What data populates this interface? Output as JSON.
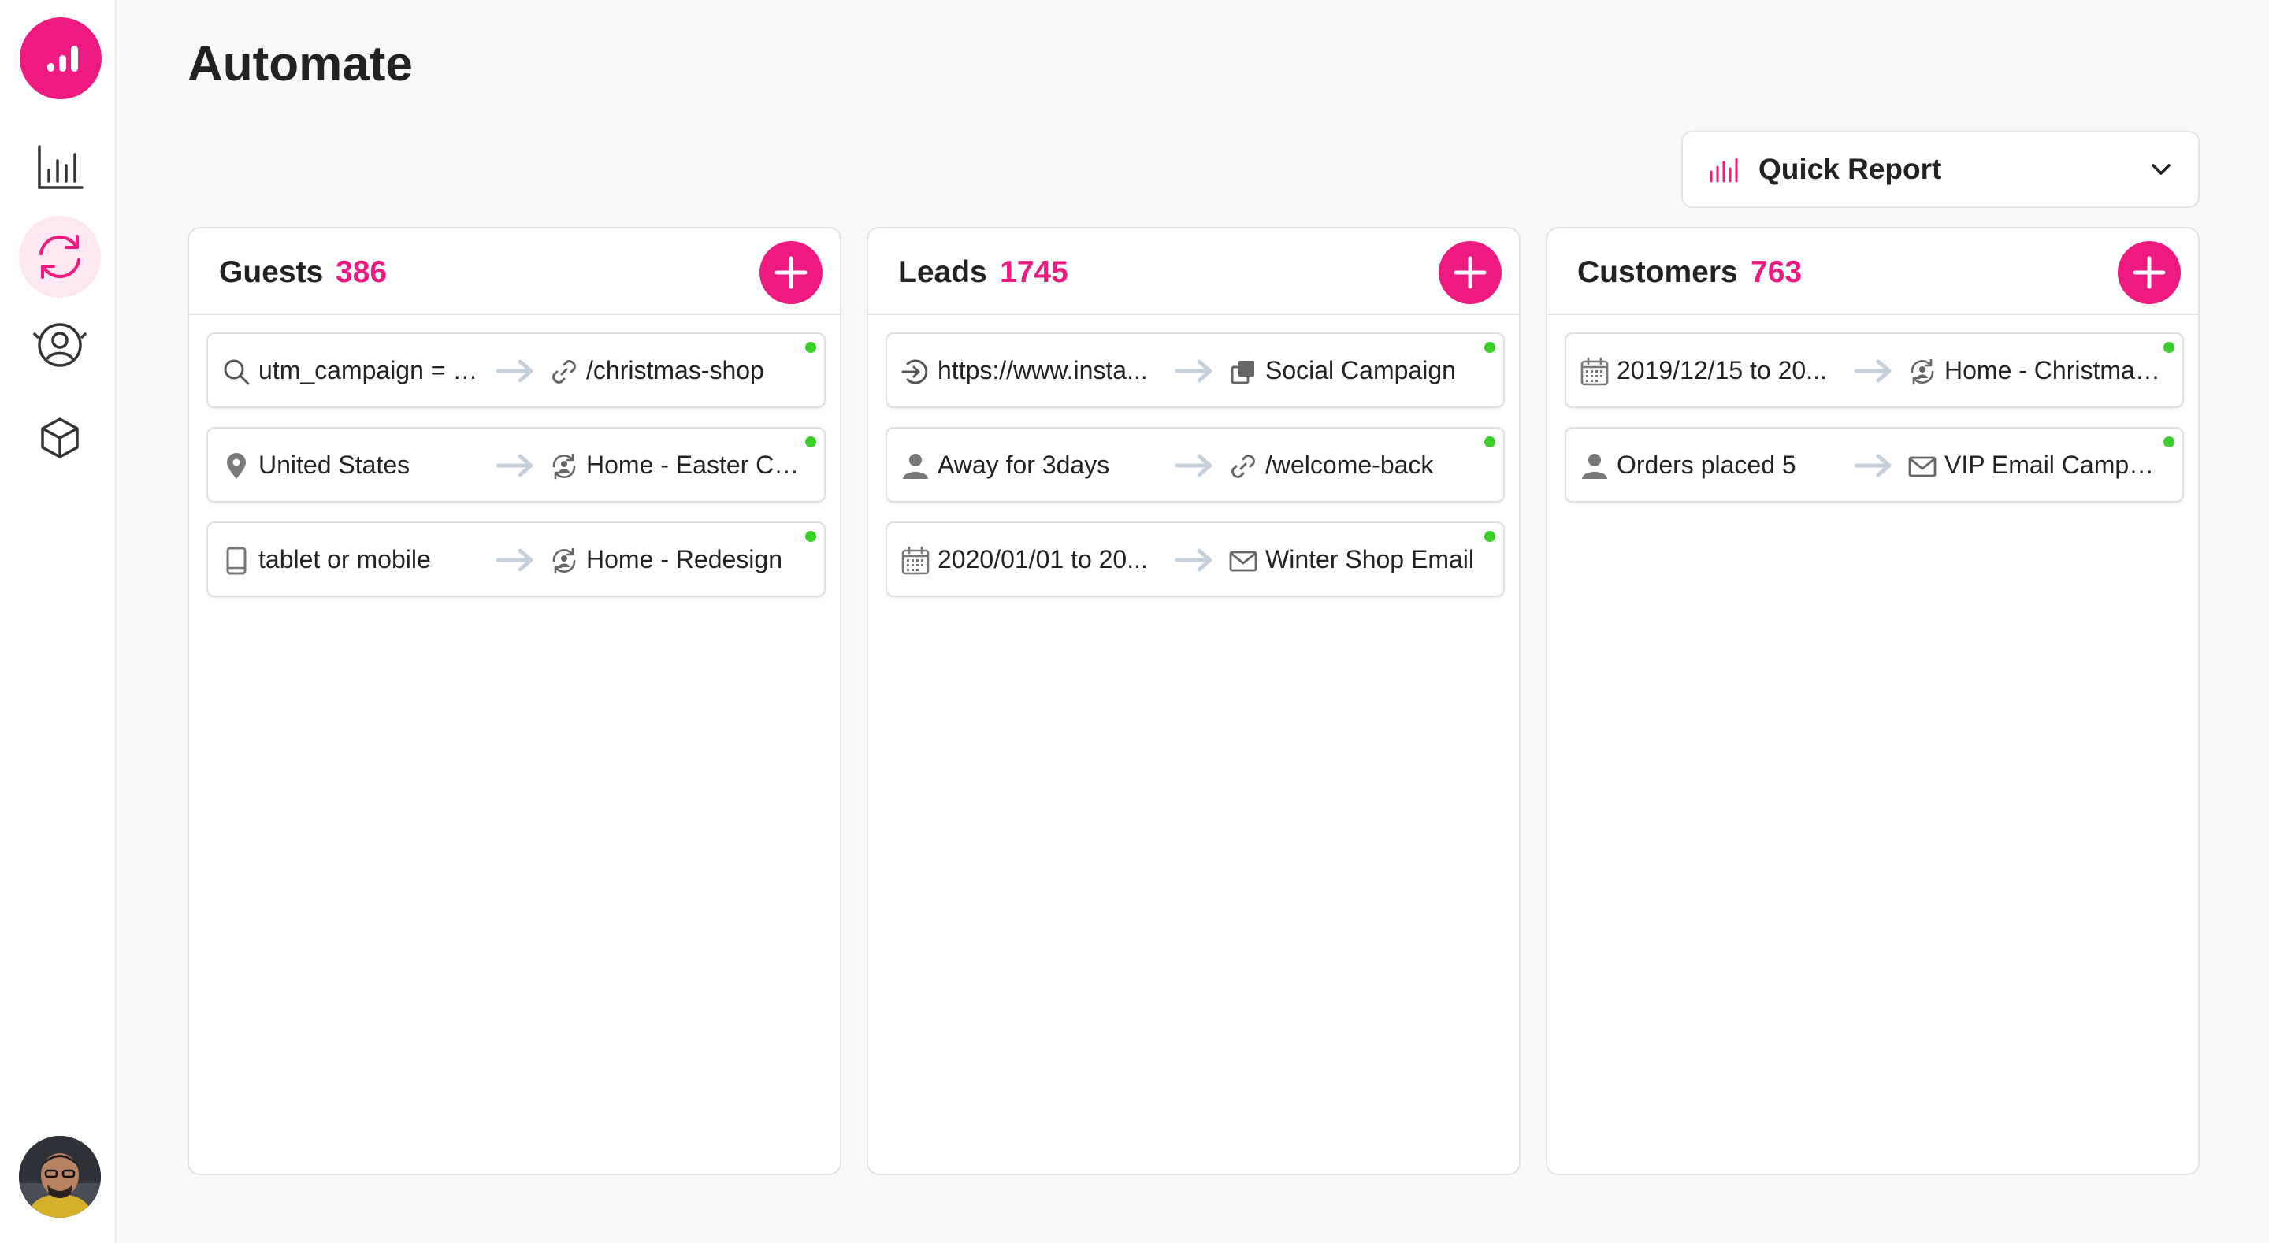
{
  "app": {
    "title": "Automate"
  },
  "sidebar": {
    "items": [
      {
        "name": "analytics",
        "icon": "bar-chart-icon"
      },
      {
        "name": "automate",
        "icon": "refresh-cycle-icon",
        "active": true
      },
      {
        "name": "audience",
        "icon": "user-circle-icon"
      },
      {
        "name": "products",
        "icon": "cube-icon"
      }
    ]
  },
  "quick_report": {
    "label": "Quick Report",
    "icon": "bar-chart-icon"
  },
  "colors": {
    "accent": "#ef1a7f",
    "status_active": "#3ccf2a",
    "arrow": "#c5d0dc"
  },
  "columns": [
    {
      "title": "Guests",
      "count": "386",
      "rules": [
        {
          "condition_icon": "search-icon",
          "condition": "utm_campaign = \"...",
          "action_icon": "link-icon",
          "action": "/christmas-shop"
        },
        {
          "condition_icon": "location-pin-icon",
          "condition": "United States",
          "action_icon": "personalization-icon",
          "action": "Home - Easter Cu..."
        },
        {
          "condition_icon": "tablet-icon",
          "condition": "tablet or mobile",
          "action_icon": "personalization-icon",
          "action": "Home - Redesign"
        }
      ]
    },
    {
      "title": "Leads",
      "count": "1745",
      "rules": [
        {
          "condition_icon": "sign-in-icon",
          "condition": "https://www.insta...",
          "action_icon": "copy-icon",
          "action": "Social Campaign"
        },
        {
          "condition_icon": "person-icon",
          "condition": "Away for 3days",
          "action_icon": "link-icon",
          "action": "/welcome-back"
        },
        {
          "condition_icon": "calendar-icon",
          "condition": "2020/01/01 to 20...",
          "action_icon": "mail-icon",
          "action": "Winter Shop Email"
        }
      ]
    },
    {
      "title": "Customers",
      "count": "763",
      "rules": [
        {
          "condition_icon": "calendar-icon",
          "condition": "2019/12/15 to 20...",
          "action_icon": "personalization-icon",
          "action": "Home - Christmas..."
        },
        {
          "condition_icon": "person-icon",
          "condition": "Orders placed 5",
          "action_icon": "mail-icon",
          "action": "VIP Email Campai..."
        }
      ]
    }
  ]
}
